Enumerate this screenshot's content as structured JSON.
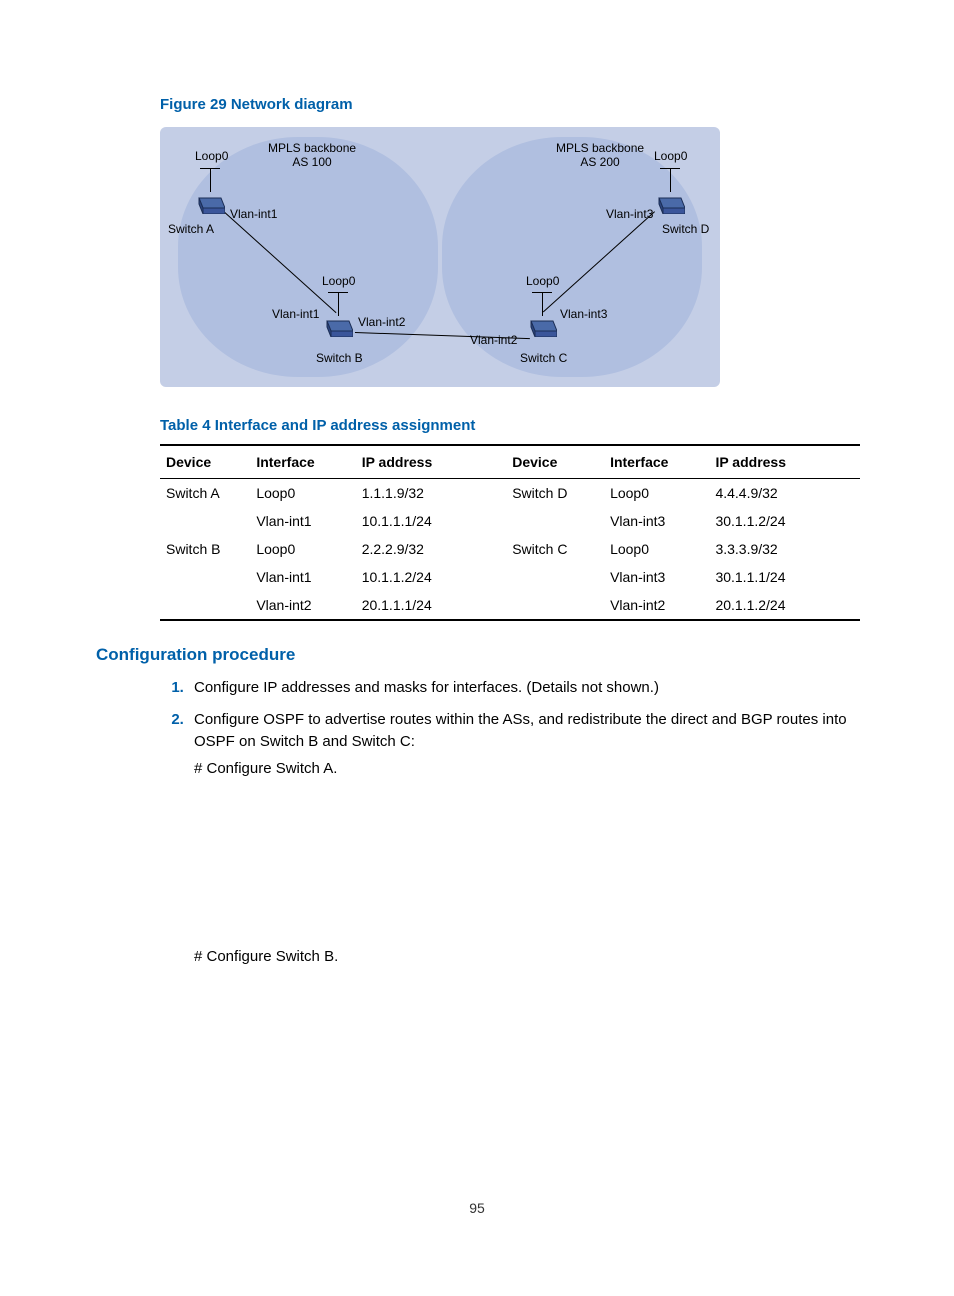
{
  "figure_caption": "Figure 29 Network diagram",
  "table_caption": "Table 4 Interface and IP address assignment",
  "section_head": "Configuration procedure",
  "page_number": "95",
  "diagram": {
    "as100": "MPLS backbone\nAS 100",
    "as200": "MPLS backbone\nAS 200",
    "switchA": "Switch A",
    "switchB": "Switch B",
    "switchC": "Switch C",
    "switchD": "Switch D",
    "loop0": "Loop0",
    "vlan1": "Vlan-int1",
    "vlan2": "Vlan-int2",
    "vlan3": "Vlan-int3"
  },
  "table": {
    "headers": [
      "Device",
      "Interface",
      "IP address",
      "Device",
      "Interface",
      "IP address"
    ],
    "rows": [
      [
        "Switch A",
        "Loop0",
        "1.1.1.9/32",
        "Switch D",
        "Loop0",
        "4.4.4.9/32"
      ],
      [
        "",
        "Vlan-int1",
        "10.1.1.1/24",
        "",
        "Vlan-int3",
        "30.1.1.2/24"
      ],
      [
        "Switch B",
        "Loop0",
        "2.2.2.9/32",
        "Switch C",
        "Loop0",
        "3.3.3.9/32"
      ],
      [
        "",
        "Vlan-int1",
        "10.1.1.2/24",
        "",
        "Vlan-int3",
        "30.1.1.1/24"
      ],
      [
        "",
        "Vlan-int2",
        "20.1.1.1/24",
        "",
        "Vlan-int2",
        "20.1.1.2/24"
      ]
    ]
  },
  "steps": {
    "s1": "Configure IP addresses and masks for interfaces. (Details not shown.)",
    "s2": "Configure OSPF to advertise routes within the ASs, and redistribute the direct and BGP routes into OSPF on Switch B and Switch C:",
    "cfgA": "# Configure Switch A.",
    "cfgB": "# Configure Switch B."
  }
}
